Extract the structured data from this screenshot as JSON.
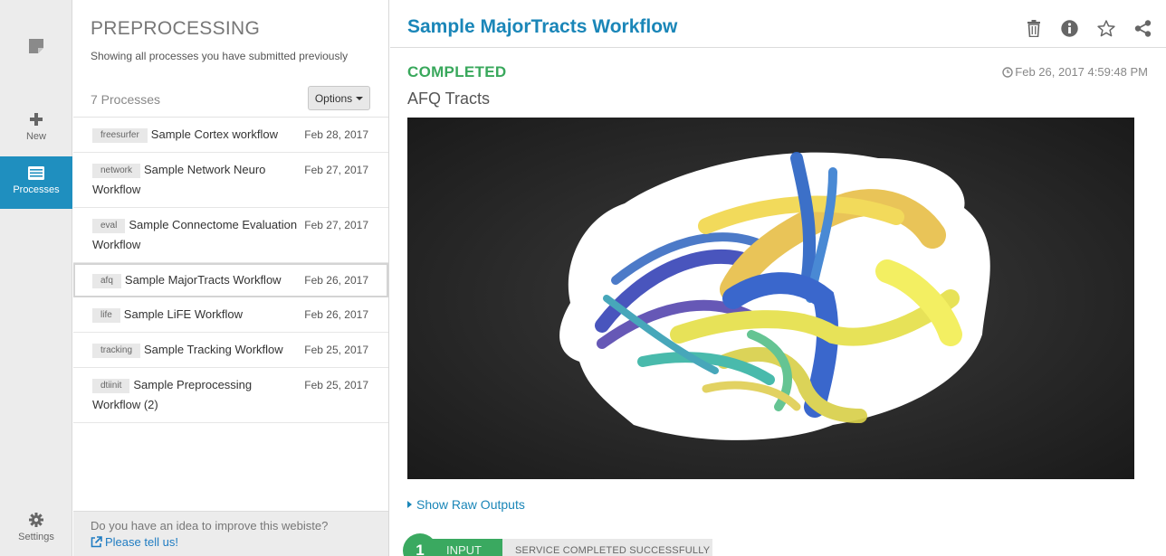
{
  "rail": {
    "new_label": "New",
    "processes_label": "Processes",
    "settings_label": "Settings"
  },
  "list": {
    "title": "PREPROCESSING",
    "subtitle": "Showing all processes you have submitted previously",
    "count": "7 Processes",
    "options_label": "Options",
    "items": [
      {
        "tag": "freesurfer",
        "name": "Sample Cortex workflow",
        "date": "Feb 28, 2017"
      },
      {
        "tag": "network",
        "name": "Sample Network Neuro Workflow",
        "date": "Feb 27, 2017"
      },
      {
        "tag": "eval",
        "name": "Sample Connectome Evaluation Workflow",
        "date": "Feb 27, 2017"
      },
      {
        "tag": "afq",
        "name": "Sample MajorTracts Workflow",
        "date": "Feb 26, 2017"
      },
      {
        "tag": "life",
        "name": "Sample LiFE Workflow",
        "date": "Feb 26, 2017"
      },
      {
        "tag": "tracking",
        "name": "Sample Tracking Workflow",
        "date": "Feb 25, 2017"
      },
      {
        "tag": "dtiinit",
        "name": "Sample Preprocessing Workflow (2)",
        "date": "Feb 25, 2017"
      }
    ],
    "selected_index": 3
  },
  "feedback": {
    "question": "Do you have an idea to improve this webiste?",
    "link": "Please tell us!"
  },
  "detail": {
    "title": "Sample MajorTracts Workflow",
    "status": "COMPLETED",
    "timestamp": "Feb 26, 2017 4:59:48 PM",
    "output_title": "AFQ Tracts",
    "raw_outputs_label": "Show Raw Outputs",
    "step": {
      "number": "1",
      "name": "INPUT",
      "message": "SERVICE COMPLETED SUCCESSFULLY"
    }
  },
  "colors": {
    "accent": "#1f8fbf",
    "title_blue": "#1a86b8",
    "success_green": "#39a85c"
  },
  "icons": [
    "note-icon",
    "plus-icon",
    "list-icon",
    "gear-icon",
    "trash-icon",
    "info-icon",
    "star-icon",
    "share-icon",
    "clock-icon",
    "external-link-icon"
  ]
}
